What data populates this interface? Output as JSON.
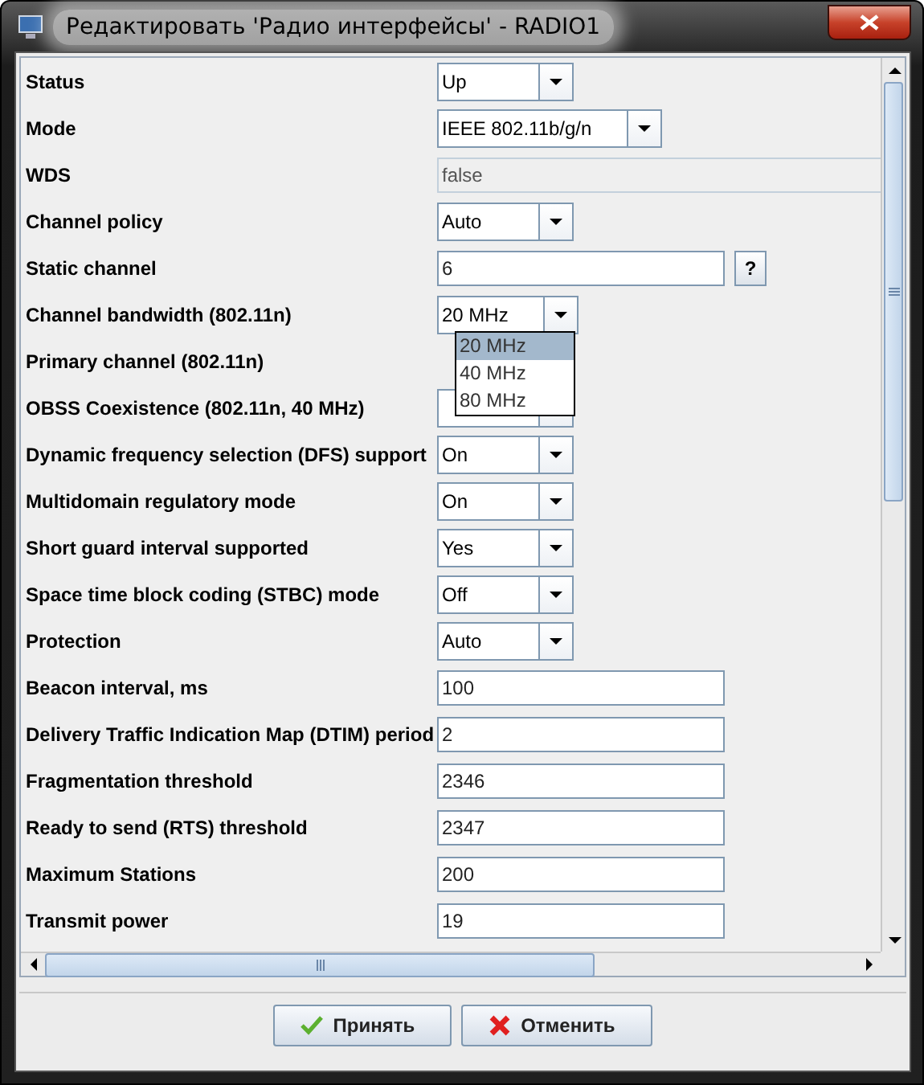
{
  "window": {
    "title": "Редактировать 'Радио интерфейсы' - RADIO1"
  },
  "rows": [
    {
      "label": "Status",
      "control": {
        "kind": "combo",
        "value": "Up"
      }
    },
    {
      "label": "Mode",
      "control": {
        "kind": "combo",
        "value": "IEEE 802.11b/g/n"
      }
    },
    {
      "label": "WDS",
      "control": {
        "kind": "readonly",
        "value": "false"
      }
    },
    {
      "label": "Channel policy",
      "control": {
        "kind": "combo",
        "value": "Auto"
      }
    },
    {
      "label": "Static channel",
      "control": {
        "kind": "text",
        "value": "6",
        "help": "?"
      }
    },
    {
      "label": "Channel bandwidth (802.11n)",
      "control": {
        "kind": "combo",
        "value": "20 MHz",
        "open": true,
        "options": [
          {
            "label": "20 MHz",
            "selected": true
          },
          {
            "label": "40 MHz",
            "selected": false
          },
          {
            "label": "80 MHz",
            "selected": false
          }
        ]
      }
    },
    {
      "label": "Primary channel (802.11n)",
      "control": {
        "kind": "hidden"
      }
    },
    {
      "label": "OBSS Coexistence (802.11n, 40 MHz)",
      "control": {
        "kind": "combo"
      }
    },
    {
      "label": "Dynamic frequency selection (DFS) support",
      "control": {
        "kind": "combo",
        "value": "On"
      }
    },
    {
      "label": "Multidomain regulatory mode",
      "control": {
        "kind": "combo",
        "value": "On"
      }
    },
    {
      "label": "Short guard interval supported",
      "control": {
        "kind": "combo",
        "value": "Yes"
      }
    },
    {
      "label": "Space time block coding (STBC) mode",
      "control": {
        "kind": "combo",
        "value": "Off"
      }
    },
    {
      "label": "Protection",
      "control": {
        "kind": "combo",
        "value": "Auto"
      }
    },
    {
      "label": "Beacon interval, ms",
      "control": {
        "kind": "text",
        "value": "100"
      }
    },
    {
      "label": "Delivery Traffic Indication Map (DTIM) period",
      "control": {
        "kind": "text",
        "value": "2"
      }
    },
    {
      "label": "Fragmentation threshold",
      "control": {
        "kind": "text",
        "value": "2346"
      }
    },
    {
      "label": "Ready to send (RTS) threshold",
      "control": {
        "kind": "text",
        "value": "2347"
      }
    },
    {
      "label": "Maximum Stations",
      "control": {
        "kind": "text",
        "value": "200"
      }
    },
    {
      "label": "Transmit power",
      "control": {
        "kind": "text",
        "value": "19"
      }
    }
  ],
  "buttons": [
    {
      "label": "Принять",
      "kind": "ok"
    },
    {
      "label": "Отменить",
      "kind": "cancel"
    }
  ]
}
